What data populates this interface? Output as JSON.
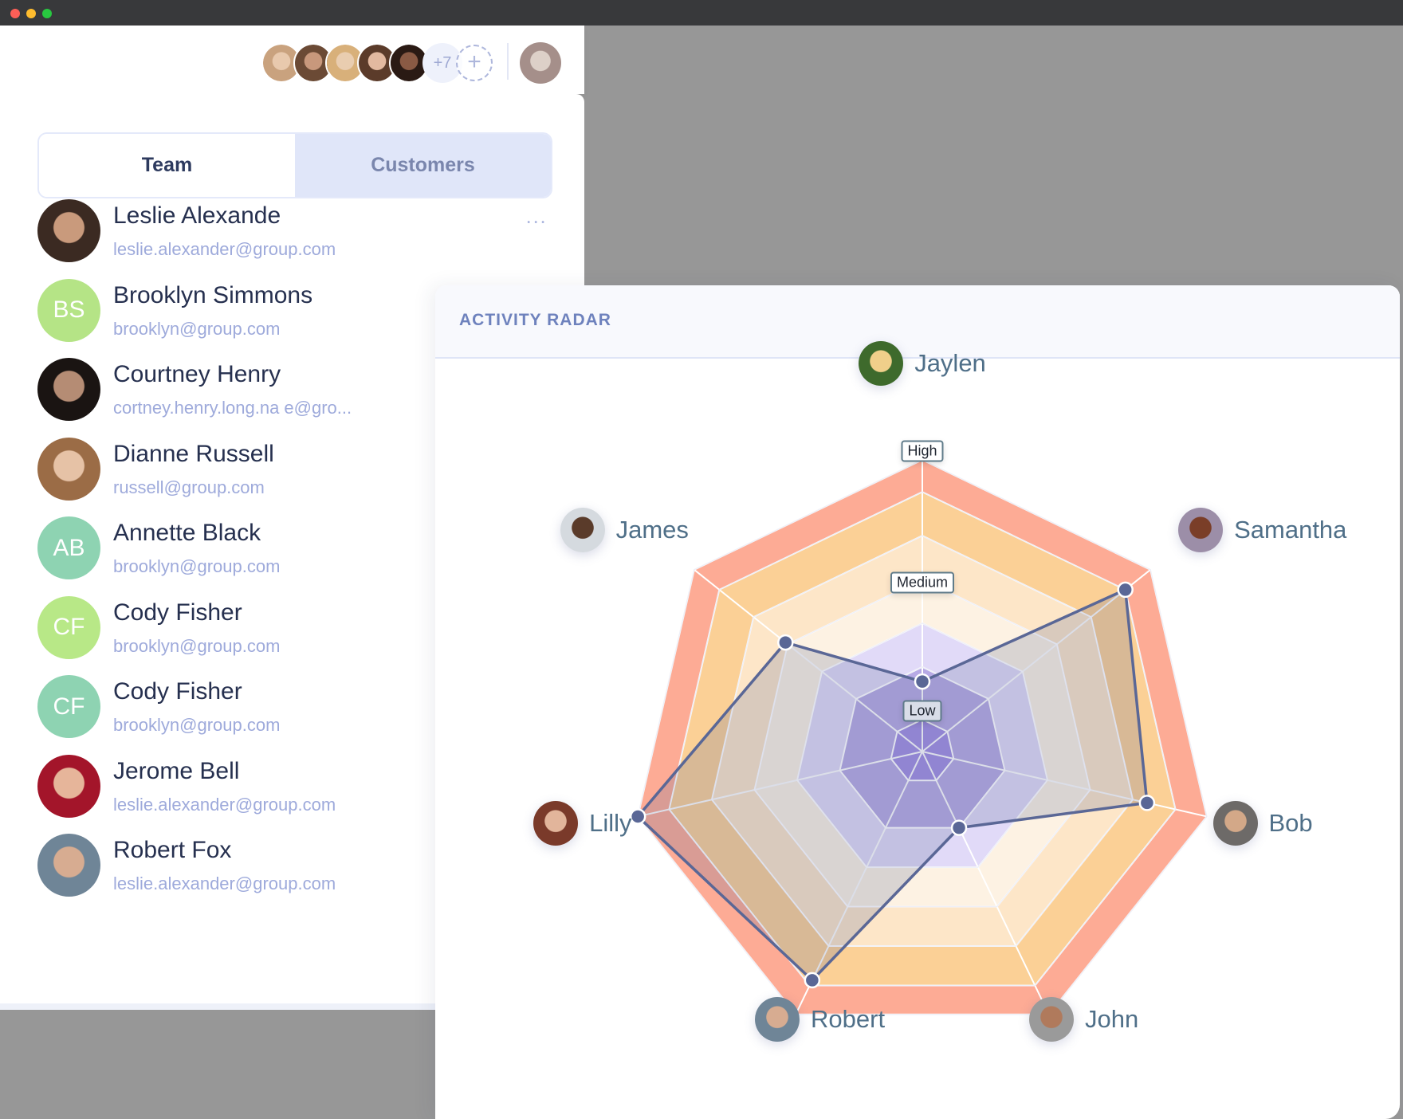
{
  "window": {
    "controls": [
      "close",
      "minimize",
      "maximize"
    ]
  },
  "topbar": {
    "avatars": [
      {
        "name": "member-1",
        "colors": [
          "#c9a27e",
          "#e8c9ad"
        ]
      },
      {
        "name": "member-2",
        "colors": [
          "#6b4a35",
          "#c8987c"
        ]
      },
      {
        "name": "member-3",
        "colors": [
          "#d8b07a",
          "#e9cdb0"
        ]
      },
      {
        "name": "member-4",
        "colors": [
          "#5b3b2a",
          "#e2b9a0"
        ]
      },
      {
        "name": "member-5",
        "colors": [
          "#2a1a14",
          "#8a5a44"
        ]
      }
    ],
    "more_count": "+7",
    "add_label": "+",
    "current_user": {
      "colors": [
        "#a58f8a",
        "#ddd0c8"
      ]
    }
  },
  "tabs": [
    {
      "label": "Team",
      "active": true
    },
    {
      "label": "Customers",
      "active": false
    }
  ],
  "people": [
    {
      "name": "Leslie Alexande",
      "email": "leslie.alexander@group.com",
      "initials": "",
      "avatar": "photo",
      "colors": [
        "#3b2a22",
        "#c99a7c"
      ],
      "show_more": true
    },
    {
      "name": "Brooklyn Simmons",
      "email": "brooklyn@group.com",
      "initials": "BS",
      "avatar": "initials",
      "colors": [
        "#b5e486"
      ]
    },
    {
      "name": "Courtney Henry",
      "email": "cortney.henry.long.na    e@gro...",
      "initials": "",
      "avatar": "photo",
      "colors": [
        "#1a1412",
        "#b58c74"
      ]
    },
    {
      "name": "Dianne Russell",
      "email": "russell@group.com",
      "initials": "",
      "avatar": "photo",
      "colors": [
        "#9b6c46",
        "#e6c2a6"
      ]
    },
    {
      "name": "Annette Black",
      "email": "brooklyn@group.com",
      "initials": "AB",
      "avatar": "initials",
      "colors": [
        "#8ed3b2"
      ]
    },
    {
      "name": "Cody Fisher",
      "email": "brooklyn@group.com",
      "initials": "CF",
      "avatar": "initials",
      "colors": [
        "#b8e887"
      ]
    },
    {
      "name": "Cody Fisher",
      "email": "brooklyn@group.com",
      "initials": "CF",
      "avatar": "initials",
      "colors": [
        "#8ed3b2"
      ]
    },
    {
      "name": "Jerome Bell",
      "email": "leslie.alexander@group.com",
      "initials": "",
      "avatar": "photo",
      "colors": [
        "#a3152a",
        "#e6b59a"
      ]
    },
    {
      "name": "Robert Fox",
      "email": "leslie.alexander@group.com",
      "initials": "",
      "avatar": "photo",
      "colors": [
        "#6f8597",
        "#d7ac91"
      ]
    }
  ],
  "radar": {
    "title": "ACTIVITY RADAR"
  },
  "chart_data": {
    "type": "radar",
    "title": "ACTIVITY RADAR",
    "axes": [
      "Jaylen",
      "Samantha",
      "Bob",
      "John",
      "Robert",
      "Lilly",
      "James"
    ],
    "axis_avatar_colors": [
      [
        "#3e6a2c",
        "#f0cf8a"
      ],
      [
        "#9c8ea8",
        "#7a3e28"
      ],
      [
        "#6d6a68",
        "#d3a888"
      ],
      [
        "#9a9a9a",
        "#b07a5c"
      ],
      [
        "#6f8597",
        "#d7ac91"
      ],
      [
        "#7a3a2a",
        "#e2b59b"
      ],
      [
        "#d5dadf",
        "#5a3b2a"
      ]
    ],
    "values": [
      0.24,
      0.89,
      0.79,
      0.29,
      0.87,
      1.0,
      0.6
    ],
    "range": [
      0,
      1
    ],
    "ring_levels": [
      0.11,
      0.29,
      0.44,
      0.59,
      0.74,
      0.89,
      1.0
    ],
    "ring_colors": [
      "#a08de3",
      "#b7aae5",
      "#e1daf8",
      "#fdf2e3",
      "#fde6c8",
      "#fbd096",
      "#fdab95"
    ],
    "level_labels": [
      {
        "label": "Low",
        "value": 0.14
      },
      {
        "label": "Medium",
        "value": 0.58
      },
      {
        "label": "High",
        "value": 1.03
      }
    ],
    "series_color": "#5a6796",
    "series_fill": "rgba(90,103,150,0.22)"
  }
}
